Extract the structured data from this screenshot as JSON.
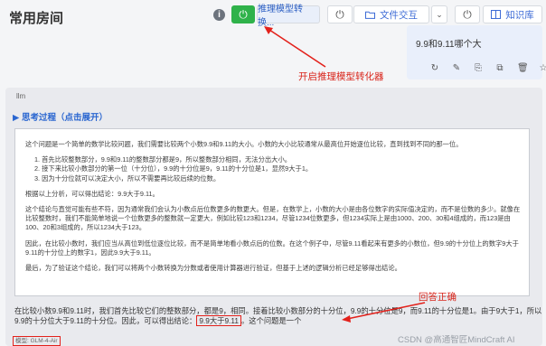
{
  "header": {
    "title": "常用房间",
    "info_icon": "i",
    "reasoning_button": "推理模型转换...",
    "file_button": "文件交互",
    "knowledge_button": "知识库",
    "power_icon": "⏻",
    "caret_icon": "⌄"
  },
  "user_message": {
    "text": "9.9和9.11哪个大",
    "toolbar": [
      "↻",
      "✎",
      "⎘",
      "⧉",
      "🗑",
      "☆"
    ]
  },
  "annotations": {
    "reasoning_toggle": "开启推理模型转化器",
    "correct_answer": "回答正确"
  },
  "response": {
    "role_label": "llm",
    "think_toggle": "▶ 思考过程（点击展开）",
    "thinking": {
      "p1": "这个问题是一个简单的数学比较问题，我们需要比较两个小数9.9和9.11的大小。小数的大小比较通常从最高位开始逐位比较，直到找到不同的那一位。",
      "list": [
        "1. 首先比较整数部分，9.9和9.11的整数部分都是9，所以整数部分相同，无法分出大小。",
        "2. 接下来比较小数部分的第一位（十分位），9.9的十分位是9，9.11的十分位是1，显然9大于1。",
        "3. 因为十分位就可以决定大小，所以不需要再比较后续的位数。"
      ],
      "p2": "根据以上分析，可以得出结论：9.9大于9.11。",
      "p3": "这个结论与直觉可能有些不符，因为通常我们会认为小数点后位数更多的数更大。但是，在数学上，小数的大小是由各位数字的实际值决定的，而不是位数的多少。就像在比较整数时，我们不能简单地说一个位数更多的整数就一定更大，例如比较123和1234，尽管1234位数更多，但1234实际上是由1000、200、30和4组成的，而123是由100、20和3组成的，所以1234大于123。",
      "p4": "因此，在比较小数时，我们应当从高位到低位逐位比较，而不是简单地看小数点后的位数。在这个例子中，尽管9.11看起来有更多的小数位，但9.9的十分位上的数字9大于9.11的十分位上的数字1，因此9.9大于9.11。",
      "p5": "最后，为了验证这个结论，我们可以将两个小数转换为分数或者使用计算器进行验证，但基于上述的逻辑分析已经足够得出结论。"
    },
    "final_before": "在比较小数9.9和9.11时，我们首先比较它们的整数部分，都是9，相同。接着比较小数部分的十分位，9.9的十分位是9，而9.11的十分位是1。由于9大于1，所以9.9的十分位大于9.11的十分位。因此，可以得出结论：",
    "final_answer": "9.9大于9.11",
    "final_after": "。这个问题是一个",
    "model_tag": "模型: GLM-4-Air"
  },
  "watermark": "CSDN @高通智匠MindCraft AI",
  "colors": {
    "accent_red": "#e3211b",
    "green_power": "#2fb24a",
    "link_blue": "#2a66d0"
  }
}
